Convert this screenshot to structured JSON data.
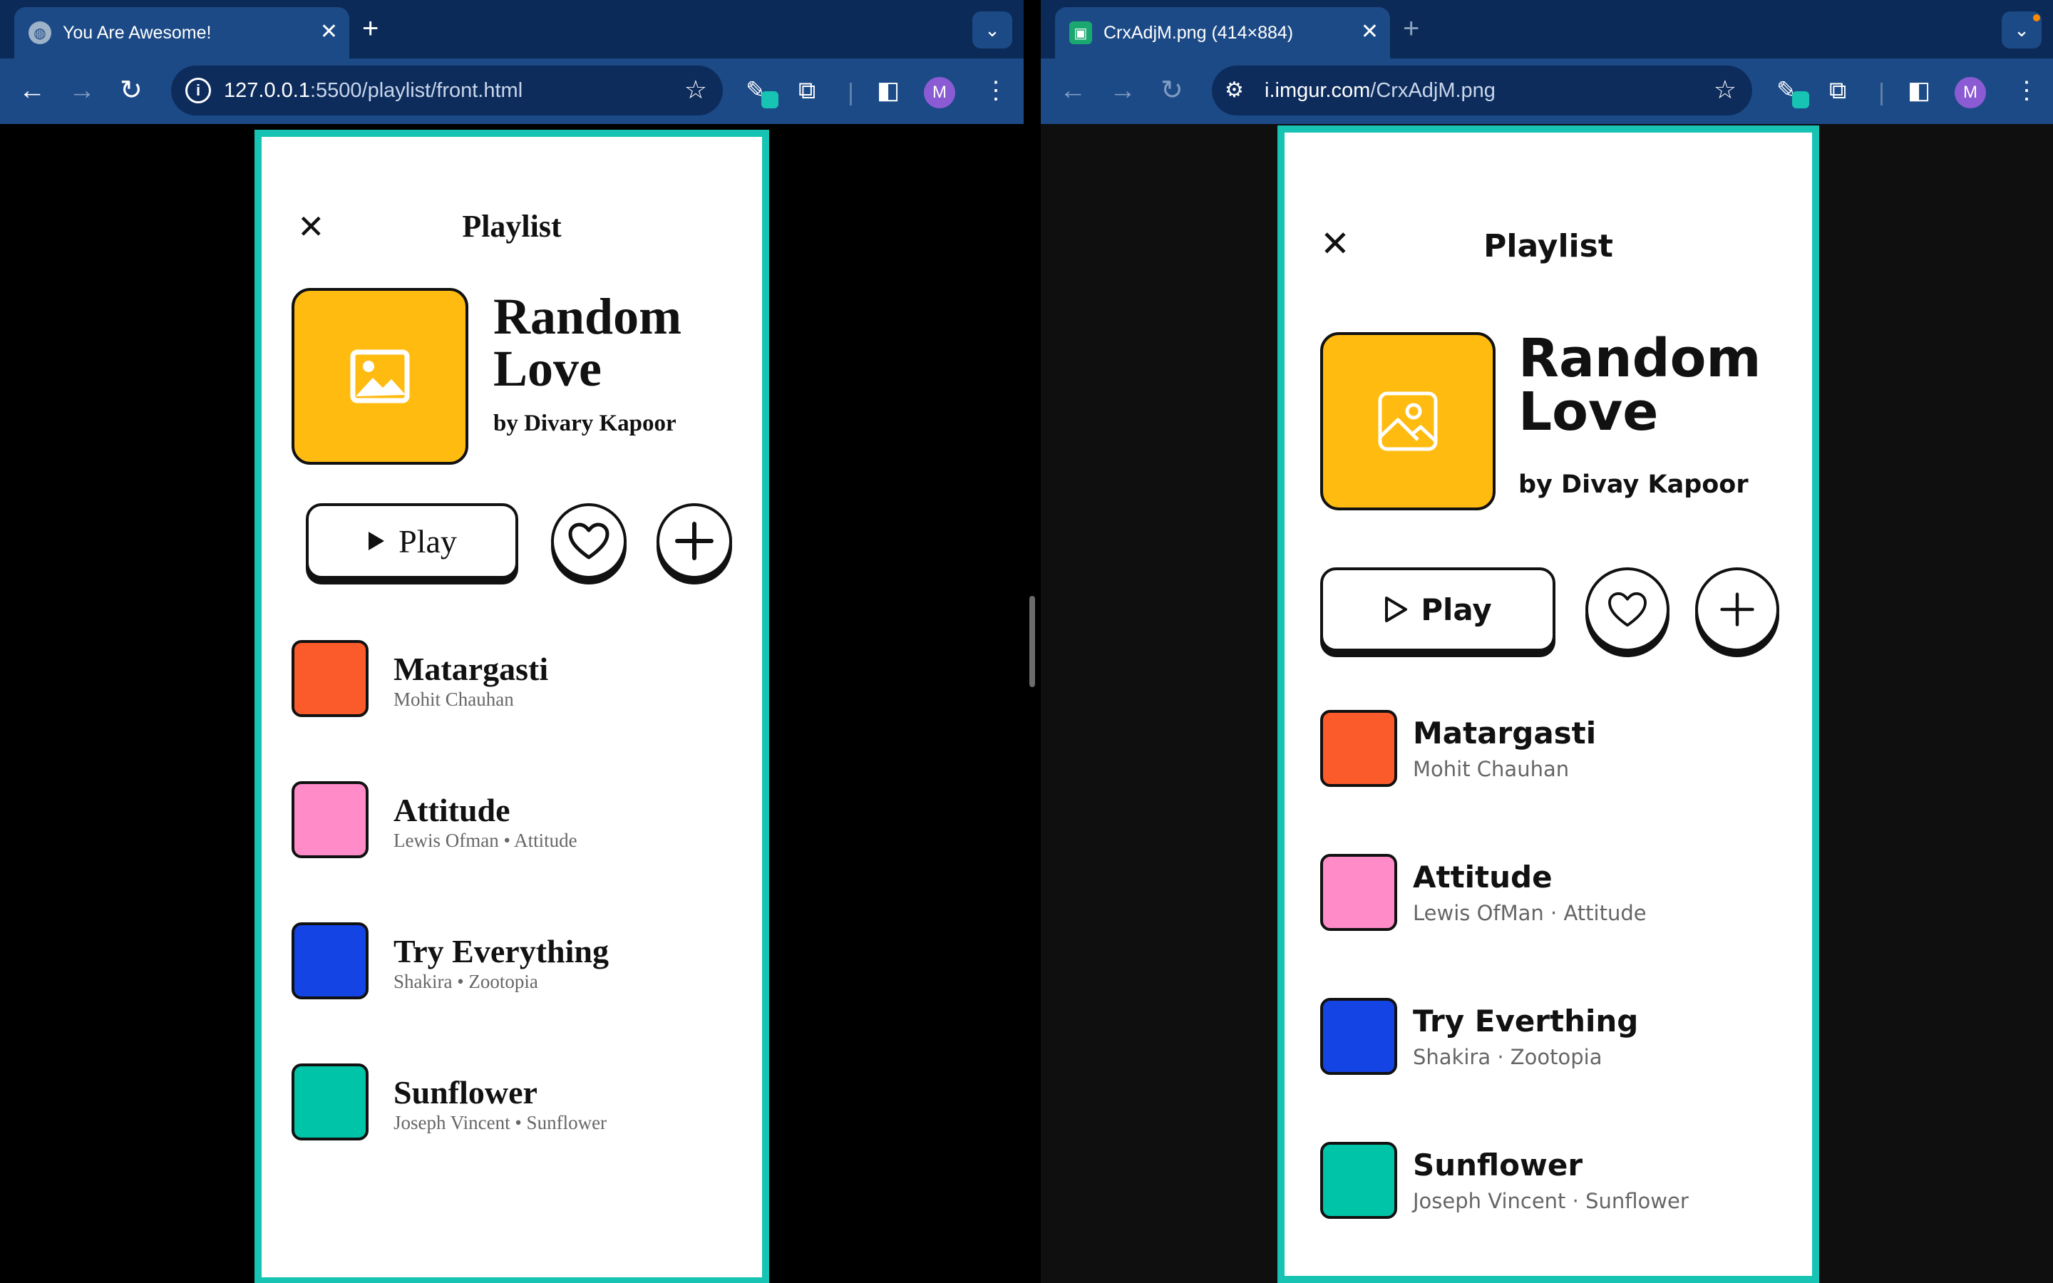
{
  "left_window": {
    "tab": {
      "title": "You Are Awesome!",
      "close": "✕"
    },
    "new_tab": "+",
    "address": {
      "host": "127.0.0.1",
      "rest": ":5500/playlist/front.html"
    },
    "profile_initial": "M",
    "screen": {
      "close": "✕",
      "header": "Playlist",
      "playlist": {
        "title_line1": "Random",
        "title_line2": "Love",
        "byline": "by Divary Kapoor",
        "cover_color": "#FFBB10"
      },
      "play_label": "Play",
      "songs": [
        {
          "title": "Matargasti",
          "subtitle": "Mohit Chauhan",
          "color": "#FB5A2B"
        },
        {
          "title": "Attitude",
          "subtitle": "Lewis Ofman • Attitude",
          "color": "#FF8BC8"
        },
        {
          "title": "Try Everything",
          "subtitle": "Shakira • Zootopia",
          "color": "#1544E5"
        },
        {
          "title": "Sunflower",
          "subtitle": "Joseph Vincent • Sunflower",
          "color": "#00C4A8"
        }
      ]
    }
  },
  "right_window": {
    "tab": {
      "title": "CrxAdjM.png (414×884)",
      "close": "✕"
    },
    "new_tab": "+",
    "address": {
      "host": "i.imgur.com",
      "rest": "/CrxAdjM.png"
    },
    "profile_initial": "M",
    "screen": {
      "close": "✕",
      "header": "Playlist",
      "playlist": {
        "title_line1": "Random",
        "title_line2": "Love",
        "byline": "by Divay Kapoor",
        "cover_color": "#FFBB10"
      },
      "play_label": "Play",
      "songs": [
        {
          "title": "Matargasti",
          "subtitle": "Mohit Chauhan",
          "color": "#FB5A2B"
        },
        {
          "title": "Attitude",
          "subtitle": "Lewis OfMan · Attitude",
          "color": "#FF8BC8"
        },
        {
          "title": "Try Everthing",
          "subtitle": "Shakira · Zootopia",
          "color": "#1544E5"
        },
        {
          "title": "Sunflower",
          "subtitle": "Joseph Vincent · Sunflower",
          "color": "#00C4A8"
        }
      ]
    }
  },
  "colors": {
    "accent_border": "#17C3B2",
    "chrome_dark": "#0B2A57",
    "chrome": "#1C4A86"
  },
  "icons": [
    "globe-icon",
    "image-icon",
    "close-icon",
    "plus-icon",
    "chevron-down-icon",
    "back-arrow-icon",
    "forward-arrow-icon",
    "reload-icon",
    "info-icon",
    "tune-icon",
    "star-icon",
    "eyedropper-icon",
    "puzzle-icon",
    "side-panel-icon",
    "kebab-menu-icon",
    "play-icon",
    "heart-icon"
  ]
}
